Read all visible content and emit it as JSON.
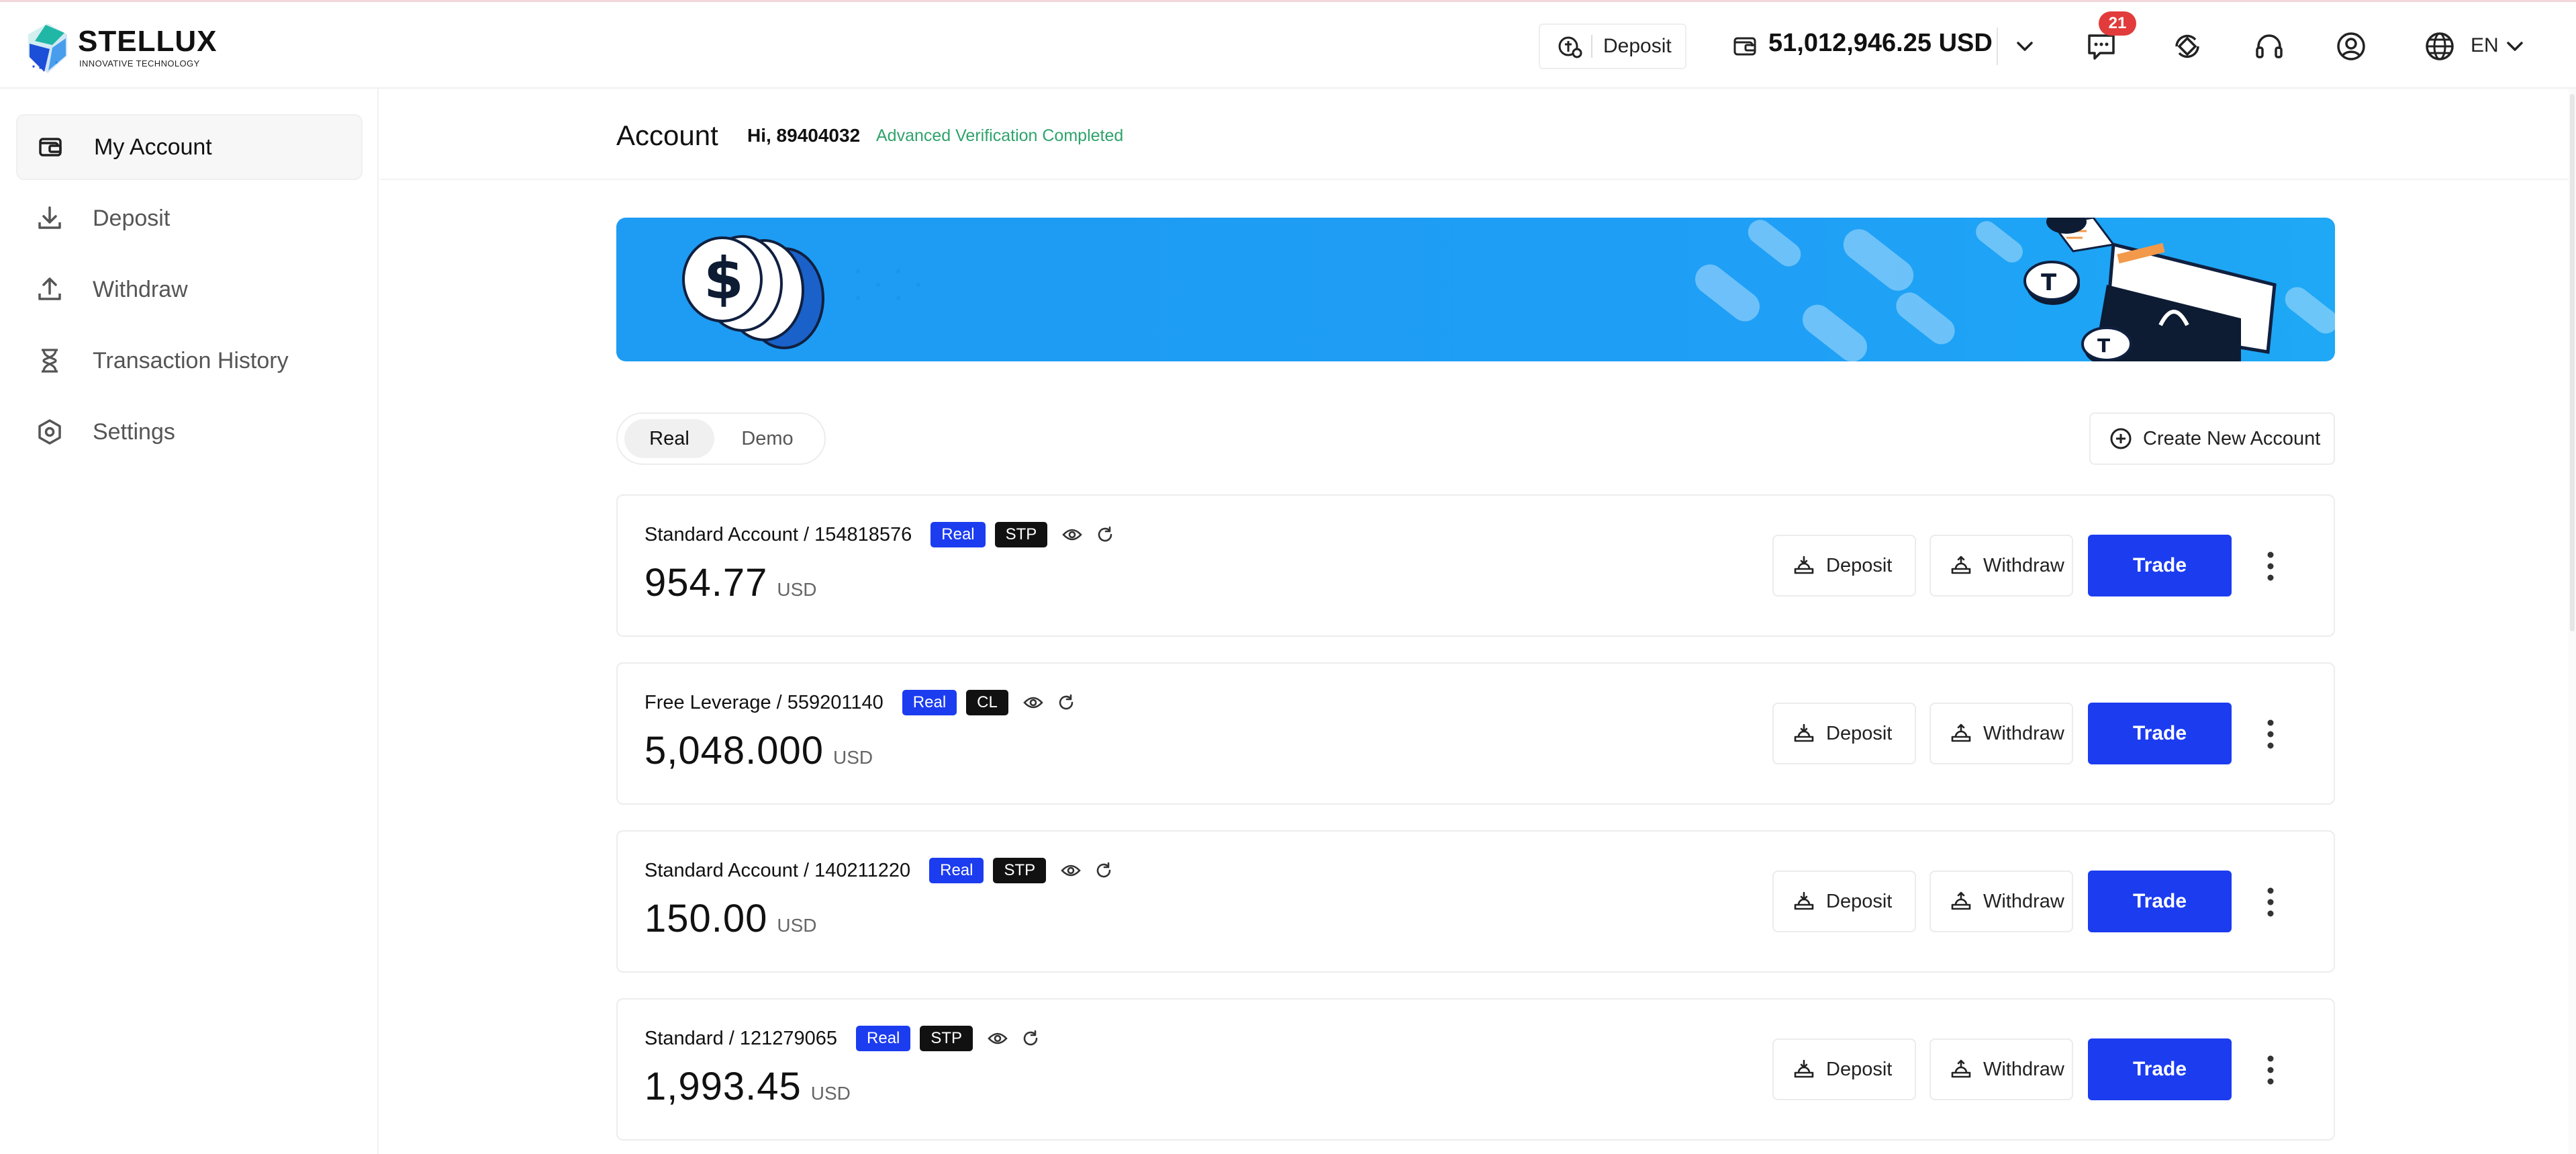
{
  "brand": {
    "name": "STELLUX",
    "tagline": "INNOVATIVE TECHNOLOGY"
  },
  "header": {
    "deposit_label": "Deposit",
    "balance": "51,012,946.25 USD",
    "notifications_count": "21",
    "language": "EN",
    "icons": {
      "deposit": "deposit-coin-icon",
      "wallet": "wallet-icon",
      "chevron": "chevron-down-icon",
      "messages": "message-icon",
      "sync": "sync-icon",
      "support": "headset-icon",
      "profile": "user-circle-icon",
      "language": "globe-icon"
    }
  },
  "sidebar": {
    "items": [
      {
        "label": "My Account",
        "icon": "wallet-icon",
        "active": true
      },
      {
        "label": "Deposit",
        "icon": "download-icon",
        "active": false
      },
      {
        "label": "Withdraw",
        "icon": "upload-icon",
        "active": false
      },
      {
        "label": "Transaction History",
        "icon": "hourglass-icon",
        "active": false
      },
      {
        "label": "Settings",
        "icon": "settings-icon",
        "active": false
      }
    ]
  },
  "main": {
    "title": "Account",
    "greeting": "Hi, 89404032",
    "verification": "Advanced Verification Completed",
    "tabs": [
      {
        "label": "Real",
        "selected": true
      },
      {
        "label": "Demo",
        "selected": false
      }
    ],
    "create_account_label": "Create New Account"
  },
  "accounts": [
    {
      "name": "Standard Account / 154818576",
      "badge": "Real",
      "type": "STP",
      "balance": "954.77",
      "currency": "USD"
    },
    {
      "name": "Free Leverage / 559201140",
      "badge": "Real",
      "type": "CL",
      "balance": "5,048.000",
      "currency": "USD"
    },
    {
      "name": "Standard Account / 140211220",
      "badge": "Real",
      "type": "STP",
      "balance": "150.00",
      "currency": "USD"
    },
    {
      "name": "Standard / 121279065",
      "badge": "Real",
      "type": "STP",
      "balance": "1,993.45",
      "currency": "USD"
    }
  ],
  "account_actions": {
    "deposit": "Deposit",
    "withdraw": "Withdraw",
    "trade": "Trade"
  },
  "colors": {
    "primary": "#1c3cf0",
    "banner": "#1e9bf3",
    "badge_alert": "#e23b3b",
    "verified": "#2fa36b",
    "type_badge": "#111111"
  }
}
